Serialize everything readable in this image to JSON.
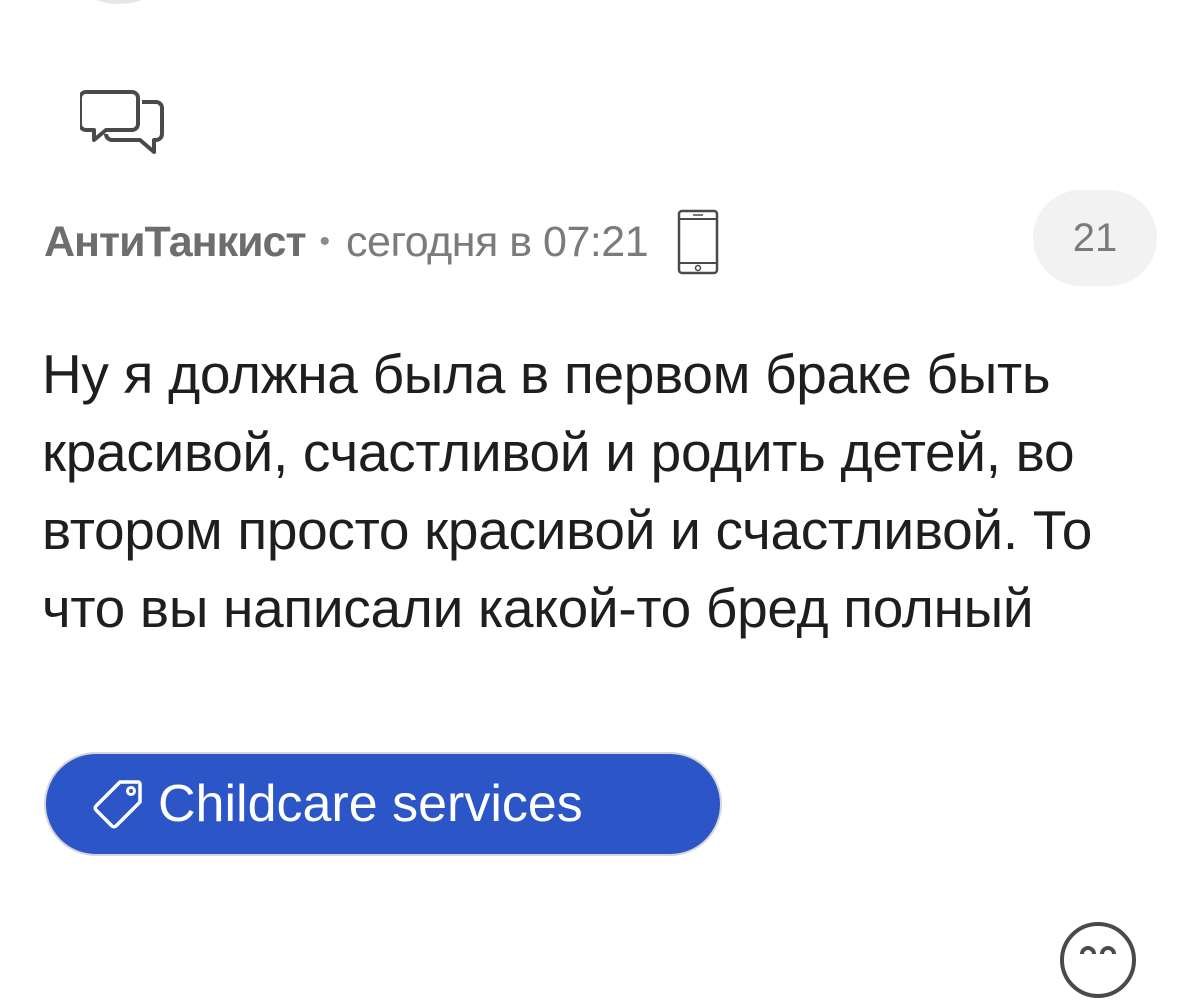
{
  "comment": {
    "author": "АнтиТанкист",
    "separator": "•",
    "timestamp": "сегодня в 07:21",
    "rating": "21",
    "text": "Ну я должна была в первом браке быть красивой, счастливой и родить детей, во втором просто красивой и счастливой. То что вы написали какой-то бред полный",
    "tag": {
      "label": "Childcare services",
      "icon": "tag-icon",
      "background": "#2c56c8"
    }
  },
  "icons": {
    "reply": "chat-bubbles-icon",
    "device": "mobile-phone-icon",
    "reaction": "smiley-icon"
  }
}
